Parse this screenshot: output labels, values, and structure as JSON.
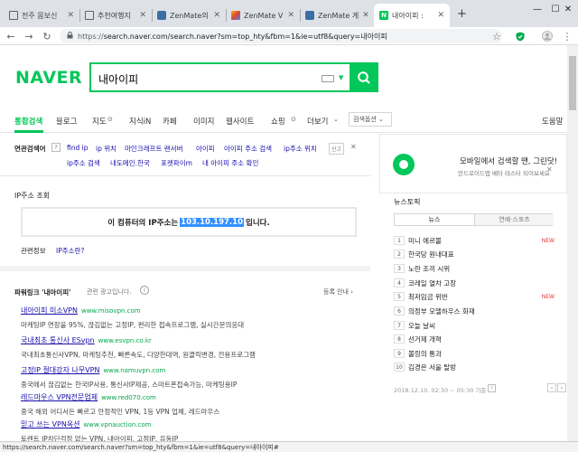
{
  "tabs": [
    {
      "label": "전주 몸보신",
      "favicon": "page-icon"
    },
    {
      "label": "추천여행지",
      "favicon": "page-icon"
    },
    {
      "label": "ZenMate의",
      "favicon": "zenmate-icon"
    },
    {
      "label": "ZenMate V",
      "favicon": "chrome-store-icon"
    },
    {
      "label": "ZenMate 게",
      "favicon": "zenmate-icon"
    },
    {
      "label": "내아이피 :",
      "favicon": "naver-icon",
      "favicon_text": "N",
      "active": true
    }
  ],
  "new_tab": "+",
  "window": {
    "minimize": "—",
    "maximize": "☐",
    "close": "✕"
  },
  "addressbar": {
    "scheme": "https://",
    "url_rest": "search.naver.com/search.naver?sm=top_hty&fbm=1&ie=utf8&query=내아이피"
  },
  "brand": {
    "logo": "NAVER",
    "accent": "#03c75a",
    "link": "#1a0dab"
  },
  "search": {
    "value": "내아이피"
  },
  "gnb": {
    "items": [
      "통합검색",
      "블로그",
      "지도",
      "지식iN",
      "카페",
      "이미지",
      "웹사이트",
      "쇼핑",
      "더보기"
    ],
    "options": "검색옵션 ⌄",
    "right": "도움말"
  },
  "related": {
    "label": "연관검색어",
    "help": "?",
    "row1": [
      "find ip",
      "ip 위치",
      "마인크래프트 랜서버",
      "아이피",
      "아이피 주소 검색",
      "ip주소 위치"
    ],
    "report": "신고",
    "row2": [
      "ip주소 검색",
      "내도메인.한국",
      "포켓파이m",
      "내 아이피 주소 확인"
    ]
  },
  "ip": {
    "title": "IP주소 조회",
    "prefix": "이 컴퓨터의 IP주소는",
    "value": "103.10.197.10",
    "suffix": "입니다.",
    "info_label": "관련정보",
    "info_link": "IP주소란?"
  },
  "power": {
    "title": "파워링크 '내아이피'",
    "sub": "관련 광고입니다.",
    "register": "등록 안내 ›",
    "ads": [
      {
        "title": "내아이피 미소VPN",
        "url": "www.misovpn.com",
        "desc": "마케팅IP 연장을 95%, 끊김없는 고정IP, 편리한 접속프로그램, 실시간문의응대"
      },
      {
        "title": "국내최초 통신사 ESvpn",
        "url": "www.esvpn.co.kr",
        "desc": "국내최초통신사VPN, 마케팅추천, 빠른속도, 다양한대역, 원클릭변경, 전용프로그램"
      },
      {
        "title": "고정IP 절대강자 나무VPN",
        "url": "www.namuvpn.com",
        "desc": "중국에서 끊김없는 한국IP사용, 통신사IP제공, 스마트폰접속가능, 마케팅용IP"
      },
      {
        "title": "레드마우스 VPN전문업체",
        "url": "www.red070.com",
        "desc": "중국 해외 어디서든 빠르고 안정적인 VPN, 1등 VPN 업체, 레드마우스"
      },
      {
        "title": "믿고 쓰는 VPN옥션",
        "url": "www.vpnauction.com",
        "desc": "토렌트 IP차단걱정 없는 VPN, 내아이피, 고정IP, 유동IP"
      }
    ]
  },
  "promo": {
    "title": "모바일에서 검색할 땐, 그린닷!",
    "sub": "안드로이드앱 베타 테스터 되어보세요",
    "close": "✕"
  },
  "news": {
    "title": "뉴스토픽",
    "tabs": [
      "뉴스",
      "연예·스포츠"
    ],
    "items": [
      {
        "num": "1",
        "text": "미니 에르볼",
        "new": "NEW"
      },
      {
        "num": "2",
        "text": "한국당 원내대표",
        "new": ""
      },
      {
        "num": "3",
        "text": "노란 조끼 시위",
        "new": ""
      },
      {
        "num": "4",
        "text": "코레일 열차 고장",
        "new": ""
      },
      {
        "num": "5",
        "text": "최저임금 위반",
        "new": "NEW"
      },
      {
        "num": "6",
        "text": "의정부 모델하우스 화재",
        "new": ""
      },
      {
        "num": "7",
        "text": "오늘 날씨",
        "new": ""
      },
      {
        "num": "8",
        "text": "선거제 개혁",
        "new": ""
      },
      {
        "num": "9",
        "text": "볼링의 통과",
        "new": ""
      },
      {
        "num": "10",
        "text": "김경은 서울 탈방",
        "new": ""
      }
    ],
    "footer": "2018.12.10. 02:30 ~ 05:30 기준"
  },
  "status": "https://search.naver.com/search.naver?sm=top_hty&fbm=1&ie=utf8&query=내아이피#"
}
